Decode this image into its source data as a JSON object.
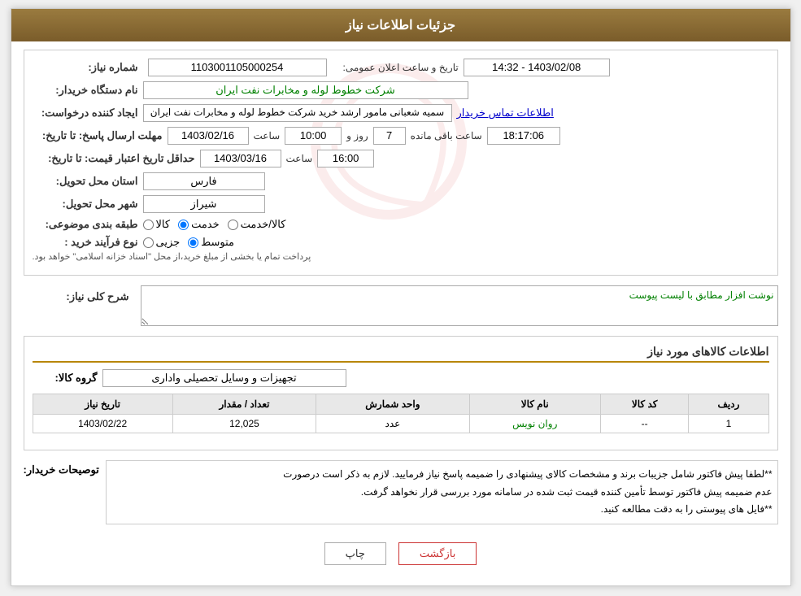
{
  "header": {
    "title": "جزئیات اطلاعات نیاز"
  },
  "fields": {
    "need_number_label": "شماره نیاز:",
    "need_number_value": "1103001105000254",
    "announcement_label": "تاریخ و ساعت اعلان عمومی:",
    "announcement_value": "1403/02/08 - 14:32",
    "buyer_name_label": "نام دستگاه خریدار:",
    "buyer_name_value": "شرکت خطوط لوله و مخابرات نفت ایران",
    "creator_label": "ایجاد کننده درخواست:",
    "creator_value": "سمیه شعبانی مامور ارشد خرید  شرکت خطوط لوله و مخابرات نفت ایران",
    "contact_link": "اطلاعات تماس خریدار",
    "send_deadline_label": "مهلت ارسال پاسخ: تا تاریخ:",
    "send_deadline_date": "1403/02/16",
    "send_deadline_time_label": "ساعت",
    "send_deadline_time": "10:00",
    "send_deadline_day_label": "روز و",
    "send_deadline_days": "7",
    "remaining_label": "ساعت باقی مانده",
    "remaining_time": "18:17:06",
    "price_validity_label": "حداقل تاریخ اعتبار قیمت: تا تاریخ:",
    "price_validity_date": "1403/03/16",
    "price_validity_time_label": "ساعت",
    "price_validity_time": "16:00",
    "province_label": "استان محل تحویل:",
    "province_value": "فارس",
    "city_label": "شهر محل تحویل:",
    "city_value": "شیراز",
    "category_label": "طبقه بندی موضوعی:",
    "category_options": [
      "کالا",
      "خدمت",
      "کالا/خدمت"
    ],
    "category_selected": "خدمت",
    "process_label": "نوع فرآیند خرید :",
    "process_options": [
      "جزیی",
      "متوسط"
    ],
    "process_selected": "متوسط",
    "process_note": "پرداخت تمام یا بخشی از مبلغ خرید،از محل \"اسناد خزانه اسلامی\" خواهد بود."
  },
  "general_description": {
    "section_label": "شرح کلی نیاز:",
    "textarea_value": "نوشت افزار مطابق با لیست پیوست"
  },
  "goods_section": {
    "title": "اطلاعات کالاهای مورد نیاز",
    "group_label": "گروه کالا:",
    "group_value": "تجهیزات و وسایل تحصیلی واداری",
    "table": {
      "columns": [
        "ردیف",
        "کد کالا",
        "نام کالا",
        "واحد شمارش",
        "تعداد / مقدار",
        "تاریخ نیاز"
      ],
      "rows": [
        {
          "row": "1",
          "code": "--",
          "name": "روان نویس",
          "unit": "عدد",
          "quantity": "12,025",
          "date": "1403/02/22"
        }
      ]
    }
  },
  "buyer_note": {
    "label": "توصیحات خریدار:",
    "line1": "**لطفا پیش فاکتور شامل جزیبات برند و مشخصات کالای پیشنهادی را ضمیمه پاسخ نیاز فرمایید. لازم به ذکر است درصورت",
    "line2": "عدم ضمیمه پیش فاکتور توسط تأمین کننده قیمت ثبت شده در سامانه مورد بررسی قرار نخواهد گرفت.",
    "line3": "**فایل های پیوستی را به دقت مطالعه کنید."
  },
  "buttons": {
    "print_label": "چاپ",
    "back_label": "بازگشت"
  }
}
